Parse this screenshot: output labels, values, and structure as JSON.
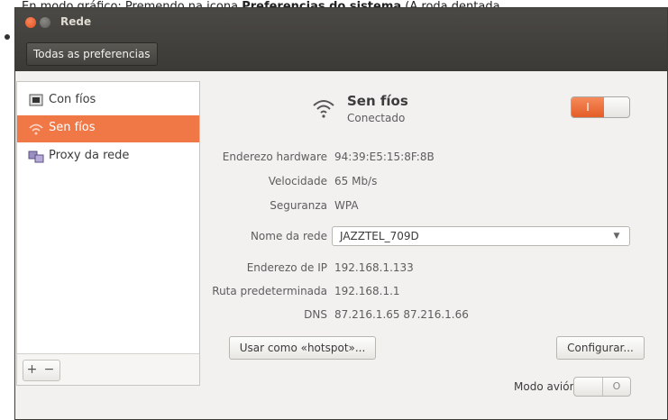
{
  "caption": {
    "prefix": "En modo gráfico: Premendo na icona ",
    "bold": "Preferencias do sistema",
    "suffix": " (A roda dentada"
  },
  "window": {
    "title": "Rede",
    "all_prefs_label": "Todas as preferencias"
  },
  "sidebar": {
    "items": [
      {
        "label": "Con fíos",
        "icon": "wired-network-icon"
      },
      {
        "label": "Sen fíos",
        "icon": "wireless-network-icon",
        "selected": true
      },
      {
        "label": "Proxy da rede",
        "icon": "proxy-icon"
      }
    ],
    "add_label": "+",
    "remove_label": "−"
  },
  "network": {
    "name": "Sen fíos",
    "status": "Conectado",
    "toggle_on_label": "I",
    "rows": [
      {
        "label": "Enderezo hardware",
        "value": "94:39:E5:15:8F:8B"
      },
      {
        "label": "Velocidade",
        "value": "65 Mb/s"
      },
      {
        "label": "Seguranza",
        "value": "WPA"
      }
    ],
    "network_name_label": "Nome da rede",
    "network_name_value": "JAZZTEL_709D",
    "rows2": [
      {
        "label": "Enderezo de IP",
        "value": "192.168.1.133"
      },
      {
        "label": "Ruta predeterminada",
        "value": "192.168.1.1"
      },
      {
        "label": "DNS",
        "value": "87.216.1.65 87.216.1.66"
      }
    ],
    "hotspot_button": "Usar como «hotspot»...",
    "configure_button": "Configurar...",
    "airplane_label": "Modo avión",
    "airplane_off_label": "O"
  },
  "colors": {
    "accent": "#f07746",
    "titlebar": "#3c3b37"
  }
}
